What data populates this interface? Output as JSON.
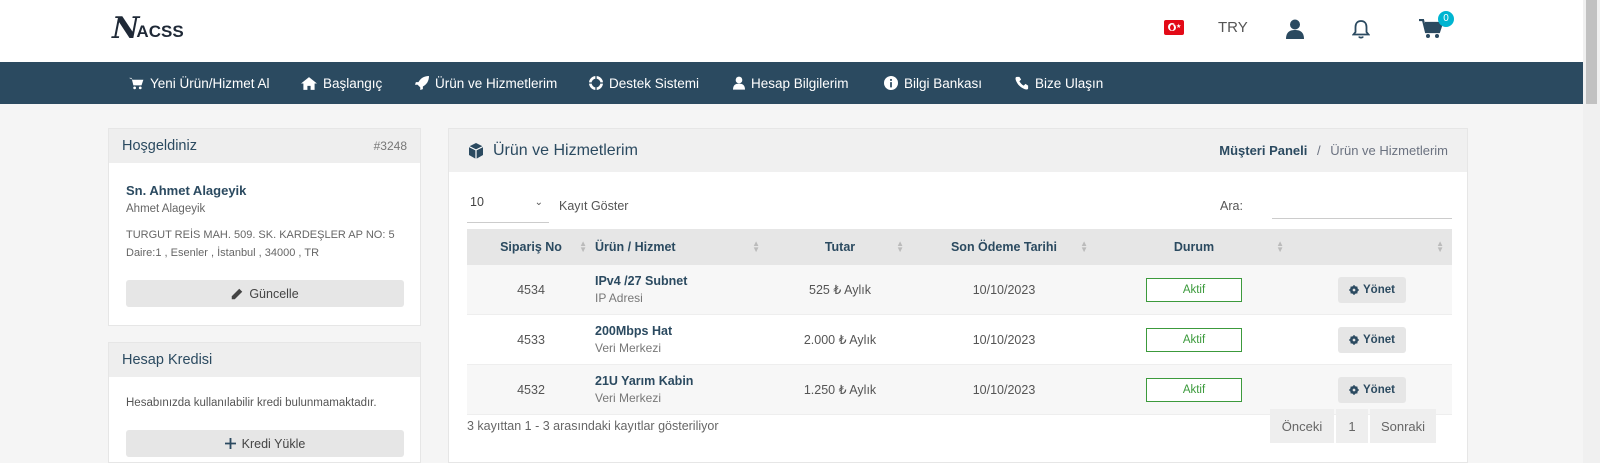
{
  "header": {
    "logo_big": "N",
    "logo_small": "ACSS",
    "currency": "TRY",
    "cart_count": "0"
  },
  "nav": [
    {
      "label": "Yeni Ürün/Hizmet Al",
      "icon": "cart-icon"
    },
    {
      "label": "Başlangıç",
      "icon": "home-icon"
    },
    {
      "label": "Ürün ve Hizmetlerim",
      "icon": "rocket-icon"
    },
    {
      "label": "Destek Sistemi",
      "icon": "lifebuoy-icon"
    },
    {
      "label": "Hesap Bilgilerim",
      "icon": "user-icon"
    },
    {
      "label": "Bilgi Bankası",
      "icon": "info-icon"
    },
    {
      "label": "Bize Ulaşın",
      "icon": "phone-icon"
    }
  ],
  "welcome": {
    "title": "Hoşgeldiniz",
    "client_id": "#3248",
    "name": "Sn. Ahmet Alageyik",
    "subname": "Ahmet Alageyik",
    "address_line1": "TURGUT REİS MAH. 509. SK. KARDEŞLER AP NO: 5",
    "address_line2": "Daire:1 , Esenler , İstanbul , 34000 , TR",
    "update_button": "Güncelle"
  },
  "credit": {
    "title": "Hesap Kredisi",
    "text": "Hesabınızda kullanılabilir kredi bulunmamaktadır.",
    "add_button": "Kredi Yükle"
  },
  "main": {
    "title": "Ürün ve Hizmetlerim",
    "breadcrumb_home": "Müşteri Paneli",
    "breadcrumb_sep": "/",
    "breadcrumb_current": "Ürün ve Hizmetlerim",
    "page_length": "10",
    "page_length_label": "Kayıt Göster",
    "search_label": "Ara:",
    "search_value": "",
    "columns": [
      "Sipariş No",
      "Ürün / Hizmet",
      "Tutar",
      "Son Ödeme Tarihi",
      "Durum",
      ""
    ],
    "rows": [
      {
        "order": "4534",
        "product": "IPv4 /27 Subnet",
        "group": "IP Adresi",
        "amount": "525 ₺ Aylık",
        "due": "10/10/2023",
        "status": "Aktif",
        "action": "Yönet"
      },
      {
        "order": "4533",
        "product": "200Mbps Hat",
        "group": "Veri Merkezi",
        "amount": "2.000 ₺ Aylık",
        "due": "10/10/2023",
        "status": "Aktif",
        "action": "Yönet"
      },
      {
        "order": "4532",
        "product": "21U Yarım Kabin",
        "group": "Veri Merkezi",
        "amount": "1.250 ₺ Aylık",
        "due": "10/10/2023",
        "status": "Aktif",
        "action": "Yönet"
      }
    ],
    "info": "3 kayıttan 1 - 3 arasındaki kayıtlar gösteriliyor",
    "pager_prev": "Önceki",
    "pager_page": "1",
    "pager_next": "Sonraki"
  },
  "colors": {
    "nav_bg": "#2b4a60",
    "status_green": "#3c9a3c",
    "badge": "#00b5d1",
    "brand_text": "#2b4a60"
  }
}
